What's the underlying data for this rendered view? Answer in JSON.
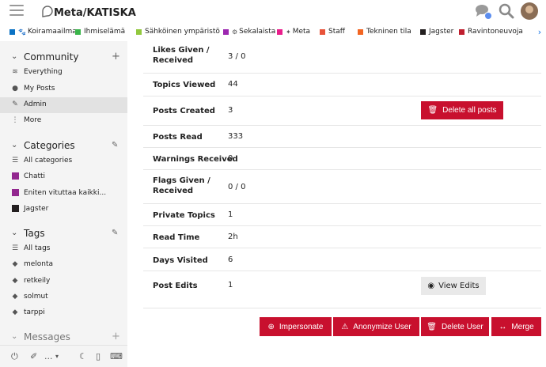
{
  "header": {
    "site_title": "Meta/KATISKA"
  },
  "categories_bar": [
    {
      "label": "Koiramaailma",
      "color": "#0b72c4",
      "glyph": "🐾"
    },
    {
      "label": "Ihmiselämä",
      "color": "#3ab54a",
      "glyph": ""
    },
    {
      "label": "Sähköinen ympäristö",
      "color": "#92c83e",
      "glyph": ""
    },
    {
      "label": "Sekalaista",
      "color": "#9c27b0",
      "glyph": "⚙"
    },
    {
      "label": "Meta",
      "color": "#e91e8c",
      "glyph": "📢"
    },
    {
      "label": "Staff",
      "color": "#e8533a",
      "glyph": ""
    },
    {
      "label": "Tekninen tila",
      "color": "#f26522",
      "glyph": ""
    },
    {
      "label": "Jagster",
      "color": "#231f20",
      "glyph": ""
    },
    {
      "label": "Ravintoneuvoja",
      "color": "#bf1e2e",
      "glyph": ""
    }
  ],
  "sidebar": {
    "community": {
      "title": "Community",
      "items": [
        {
          "label": "Everything",
          "icon": "layers-icon"
        },
        {
          "label": "My Posts",
          "icon": "user-icon"
        },
        {
          "label": "Admin",
          "icon": "wrench-icon",
          "active": true
        },
        {
          "label": "More",
          "icon": "ellipsis-icon"
        }
      ]
    },
    "categories": {
      "title": "Categories",
      "items": [
        {
          "label": "All categories",
          "icon": "list-icon"
        },
        {
          "label": "Chatti",
          "color": "#92278f"
        },
        {
          "label": "Eniten vituttaa kaikki...",
          "color": "#92278f"
        },
        {
          "label": "Jagster",
          "color": "#231f20"
        }
      ]
    },
    "tags": {
      "title": "Tags",
      "items": [
        {
          "label": "All tags",
          "icon": "list-icon"
        },
        {
          "label": "melonta",
          "icon": "tag-icon"
        },
        {
          "label": "retkeily",
          "icon": "tag-icon"
        },
        {
          "label": "solmut",
          "icon": "tag-icon"
        },
        {
          "label": "tarppi",
          "icon": "tag-icon"
        }
      ]
    },
    "messages": {
      "title": "Messages"
    },
    "footer": {
      "more_label": "..."
    }
  },
  "stats": [
    {
      "label": "Likes Given / Received",
      "value": "3 / 0"
    },
    {
      "label": "Topics Viewed",
      "value": "44"
    },
    {
      "label": "Posts Created",
      "value": "3",
      "action": "Delete all posts"
    },
    {
      "label": "Posts Read",
      "value": "333"
    },
    {
      "label": "Warnings Received",
      "value": "0"
    },
    {
      "label": "Flags Given / Received",
      "value": "0 / 0"
    },
    {
      "label": "Private Topics",
      "value": "1"
    },
    {
      "label": "Read Time",
      "value": "2h"
    },
    {
      "label": "Days Visited",
      "value": "6"
    },
    {
      "label": "Post Edits",
      "value": "1",
      "action": "View Edits"
    }
  ],
  "actions": {
    "impersonate": "Impersonate",
    "anonymize": "Anonymize User",
    "delete_user": "Delete User",
    "merge": "Merge"
  },
  "colors": {
    "danger": "#c8102e",
    "sidebar_bg": "#f4f4f4",
    "link": "#0b6ee6"
  }
}
